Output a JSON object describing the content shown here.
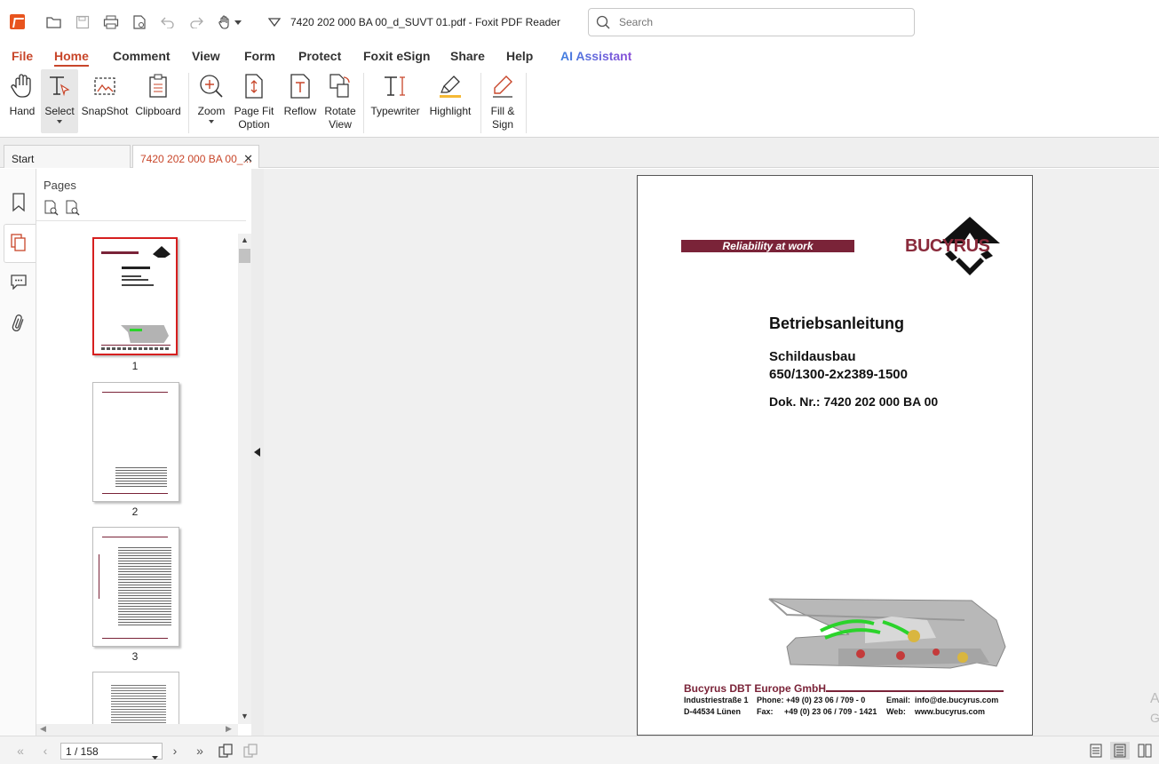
{
  "window": {
    "title": "7420 202 000 BA 00_d_SUVT 01.pdf - Foxit PDF Reader"
  },
  "search": {
    "placeholder": "Search"
  },
  "menu": {
    "items": [
      "File",
      "Home",
      "Comment",
      "View",
      "Form",
      "Protect",
      "Foxit eSign",
      "Share",
      "Help",
      "AI Assistant"
    ],
    "active": "Home"
  },
  "ribbon": {
    "hand": "Hand",
    "select": "Select",
    "snapshot": "SnapShot",
    "clipboard": "Clipboard",
    "zoom": "Zoom",
    "page_fit": "Page Fit\nOption",
    "reflow": "Reflow",
    "rotate": "Rotate\nView",
    "typewriter": "Typewriter",
    "highlight": "Highlight",
    "fill_sign": "Fill &\nSign"
  },
  "tabs": {
    "start": "Start",
    "document": "7420 202 000 BA 00_..."
  },
  "pages_panel": {
    "title": "Pages",
    "thumbnails": [
      "1",
      "2",
      "3"
    ]
  },
  "document": {
    "slogan": "Reliability at work",
    "brand": "BUCYRUS",
    "title": "Betriebsanleitung",
    "subtitle1": "Schildausbau",
    "subtitle2": "650/1300-2x2389-1500",
    "doc_number": "Dok. Nr.: 7420 202 000 BA 00",
    "footer": {
      "company": "Bucyrus DBT Europe GmbH",
      "street": "Industriestraße 1",
      "city": "D-44534 Lünen",
      "phone": "Phone: +49 (0) 23 06 / 709 - 0",
      "fax": "Fax:     +49 (0) 23 06 / 709 - 1421",
      "email": "Email:  info@de.bucyrus.com",
      "web": "Web:    www.bucyrus.com"
    }
  },
  "status": {
    "page_indicator": "1 / 158"
  },
  "colors": {
    "accent": "#c8462a",
    "brand": "#7a2338",
    "selected_thumb": "#d61f1f"
  },
  "icons": [
    "app-logo-icon",
    "open-icon",
    "save-icon",
    "print-icon",
    "properties-icon",
    "undo-icon",
    "redo-icon",
    "hand-tool-icon",
    "chevron-down-icon",
    "search-icon",
    "bookmark-icon",
    "pages-icon",
    "comment-icon",
    "attachment-icon",
    "first-page-icon",
    "prev-page-icon",
    "next-page-icon",
    "last-page-icon",
    "single-page-icon",
    "continuous-icon",
    "two-page-icon"
  ]
}
